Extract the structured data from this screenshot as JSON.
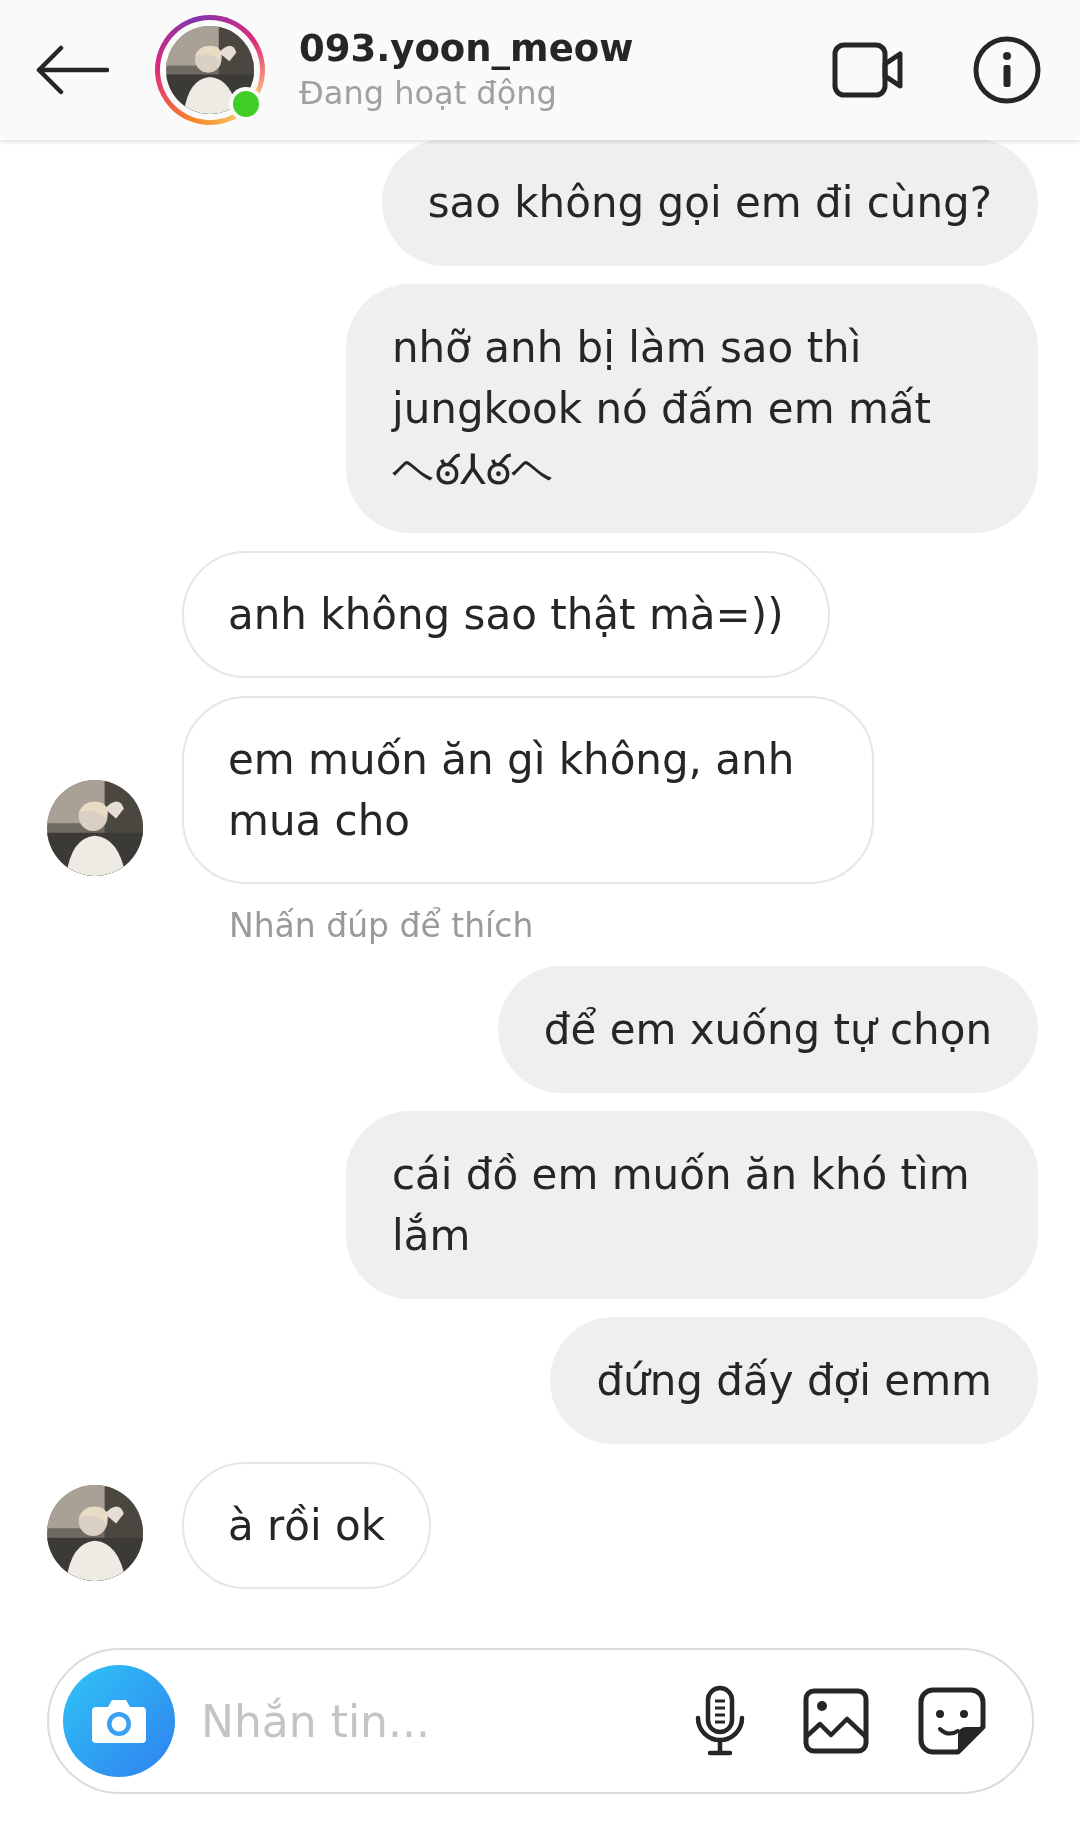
{
  "header": {
    "username": "093.yoon_meow",
    "status": "Đang hoạt động",
    "online": true
  },
  "messages": [
    {
      "kind": "sent",
      "text": "sao không gọi em đi cùng?"
    },
    {
      "kind": "sent",
      "text": "nhỡ anh bị làm sao thì jungkook nó đấm em mất ヘఠ⅄ఠヘ"
    },
    {
      "kind": "received",
      "text": "anh không sao thật mà=))",
      "avatar": false
    },
    {
      "kind": "received",
      "text": "em muốn ăn gì không, anh mua cho",
      "avatar": true
    },
    {
      "kind": "hint",
      "text": "Nhấn đúp để thích"
    },
    {
      "kind": "sent",
      "text": "để em xuống tự chọn"
    },
    {
      "kind": "sent",
      "text": "cái đồ em muốn ăn khó tìm lắm"
    },
    {
      "kind": "sent",
      "text": "đứng đấy đợi emm"
    },
    {
      "kind": "received",
      "text": "à rồi ok",
      "avatar": true
    }
  ],
  "composer": {
    "placeholder": "Nhắn tin..."
  }
}
